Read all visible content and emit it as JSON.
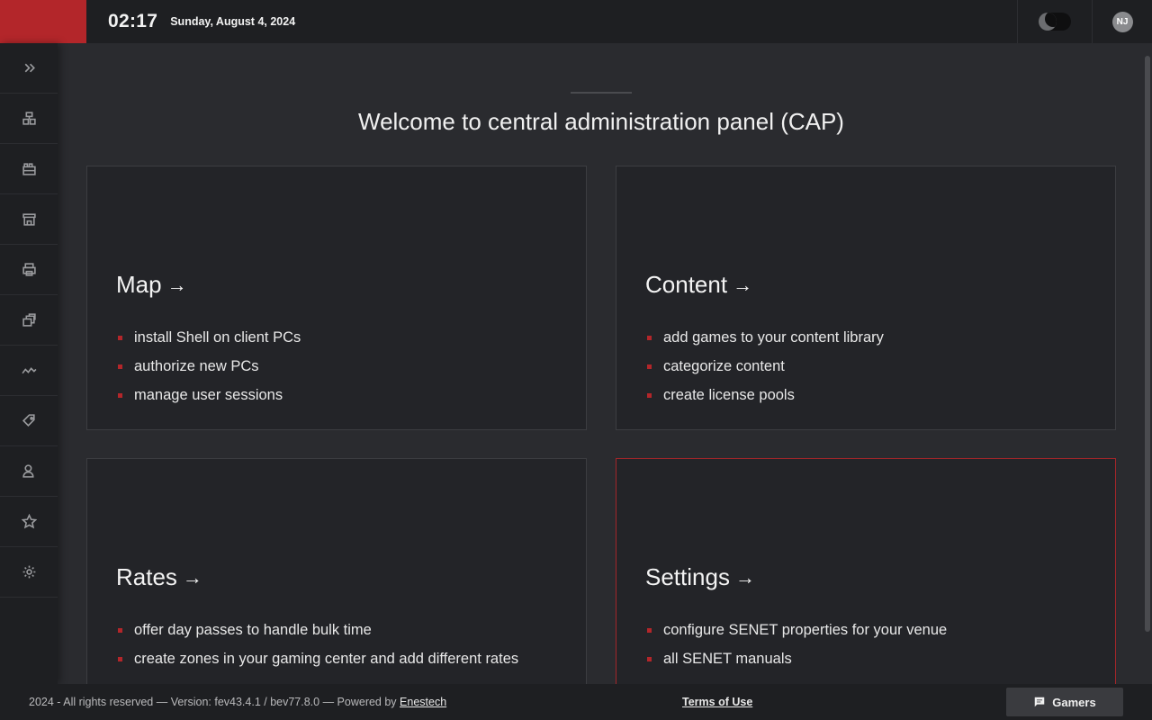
{
  "header": {
    "time": "02:17",
    "date": "Sunday, August 4, 2024",
    "theme_toggle_icon": "moon-toggle-icon",
    "avatar_initials": "NJ"
  },
  "sidebar": {
    "items": [
      {
        "icon": "expand-chevrons-icon"
      },
      {
        "icon": "dashboard-icon"
      },
      {
        "icon": "content-library-icon"
      },
      {
        "icon": "store-icon"
      },
      {
        "icon": "printer-icon"
      },
      {
        "icon": "stacked-windows-icon"
      },
      {
        "icon": "activity-graph-icon"
      },
      {
        "icon": "tag-settings-icon"
      },
      {
        "icon": "users-icon"
      },
      {
        "icon": "star-icon"
      },
      {
        "icon": "gear-icon"
      }
    ]
  },
  "main": {
    "welcome": "Welcome to central administration panel (CAP)",
    "cards": [
      {
        "title": "Map",
        "items": [
          "install Shell on client PCs",
          "authorize new PCs",
          "manage user sessions"
        ]
      },
      {
        "title": "Content",
        "items": [
          "add games to your content library",
          "categorize content",
          "create license pools"
        ]
      },
      {
        "title": "Rates",
        "items": [
          "offer day passes to handle bulk time",
          "create zones in your gaming center and add different rates"
        ]
      },
      {
        "title": "Settings",
        "items": [
          "configure SENET properties for your venue",
          "all SENET manuals"
        ]
      }
    ]
  },
  "footer": {
    "copyright": "2024 - All rights reserved — Version: fev43.4.1 / bev77.8.0 — Powered by ",
    "powered_link": "Enestech",
    "terms": "Terms of Use",
    "gamers_button": "Gamers"
  },
  "colors": {
    "accent": "#b3262a",
    "background": "#2a2b2f",
    "panel": "#1e1f22"
  }
}
